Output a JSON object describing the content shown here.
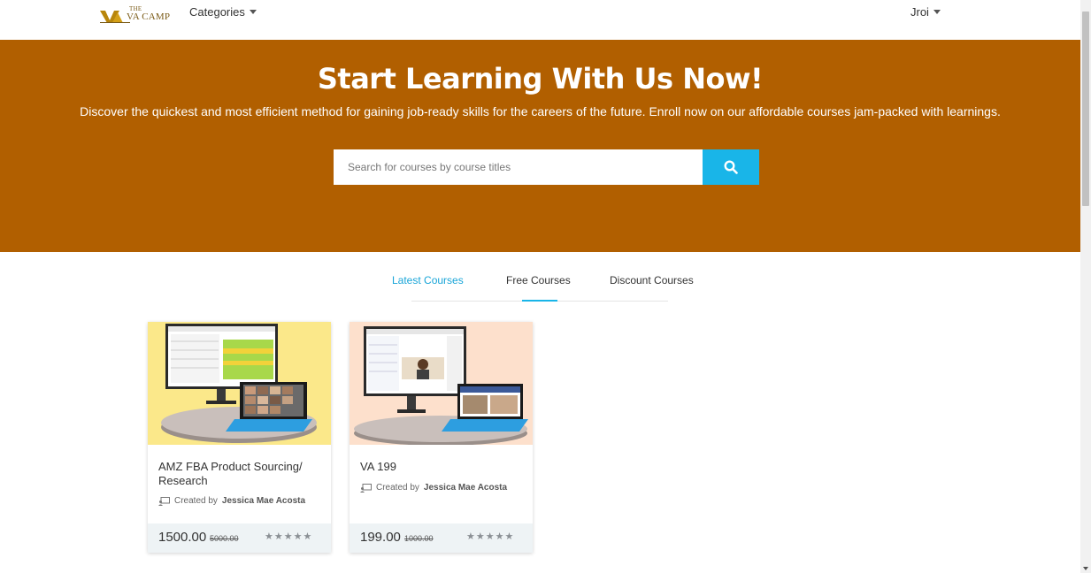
{
  "navbar": {
    "logo": {
      "small": "THE",
      "name": "VA CAMP"
    },
    "categories_label": "Categories",
    "user_label": "Jroi"
  },
  "hero": {
    "title": "Start Learning With Us Now!",
    "subtitle": "Discover the quickest and most efficient method for gaining job-ready skills for the careers of the future. Enroll now on our affordable courses jam-packed with learnings.",
    "search_placeholder": "Search for courses by course titles"
  },
  "tabs": {
    "items": [
      "Latest Courses",
      "Free Courses",
      "Discount Courses"
    ],
    "active": "Latest Courses"
  },
  "courses": [
    {
      "title": "AMZ FBA Product Sourcing/ Research",
      "creator_prefix": "Created by",
      "creator": "Jessica Mae Acosta",
      "price": "1500.00",
      "old_price": "5000.00",
      "rating": 0
    },
    {
      "title": "VA 199",
      "creator_prefix": "Created by",
      "creator": "Jessica Mae Acosta",
      "price": "199.00",
      "old_price": "1000.00",
      "rating": 0
    }
  ],
  "colors": {
    "hero_bg": "#b15f00",
    "accent": "#19b5e8",
    "card_footer": "#eef3f5"
  }
}
